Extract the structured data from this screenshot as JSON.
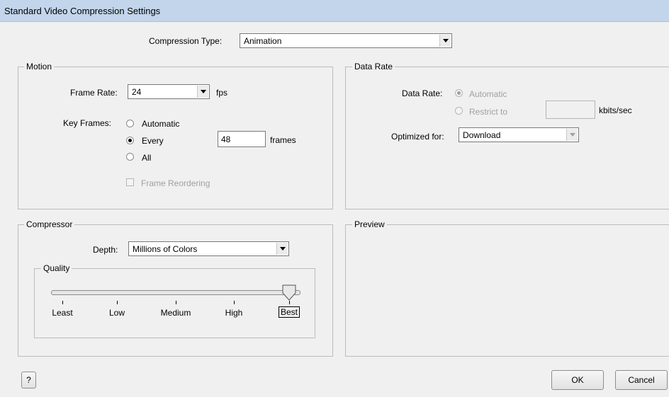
{
  "window": {
    "title": "Standard Video Compression Settings"
  },
  "compression": {
    "label": "Compression Type:",
    "value": "Animation"
  },
  "motion": {
    "legend": "Motion",
    "frame_rate_label": "Frame Rate:",
    "frame_rate_value": "24",
    "fps_label": "fps",
    "key_frames_label": "Key Frames:",
    "options": [
      "Automatic",
      "Every",
      "All"
    ],
    "selected": "Every",
    "every_value": "48",
    "frames_label": "frames",
    "frame_reordering_label": "Frame Reordering",
    "frame_reordering_checked": false
  },
  "data_rate": {
    "legend": "Data Rate",
    "label": "Data Rate:",
    "automatic_label": "Automatic",
    "restrict_label": "Restrict to",
    "restrict_value": "",
    "unit_label": "kbits/sec",
    "optimized_label": "Optimized for:",
    "optimized_value": "Download"
  },
  "compressor": {
    "legend": "Compressor",
    "depth_label": "Depth:",
    "depth_value": "Millions of Colors",
    "quality_legend": "Quality",
    "quality_ticks": [
      "Least",
      "Low",
      "Medium",
      "High",
      "Best"
    ],
    "quality_selected": "Best",
    "quality_level": 1.0
  },
  "preview": {
    "legend": "Preview"
  },
  "buttons": {
    "help": "?",
    "ok": "OK",
    "cancel": "Cancel"
  }
}
